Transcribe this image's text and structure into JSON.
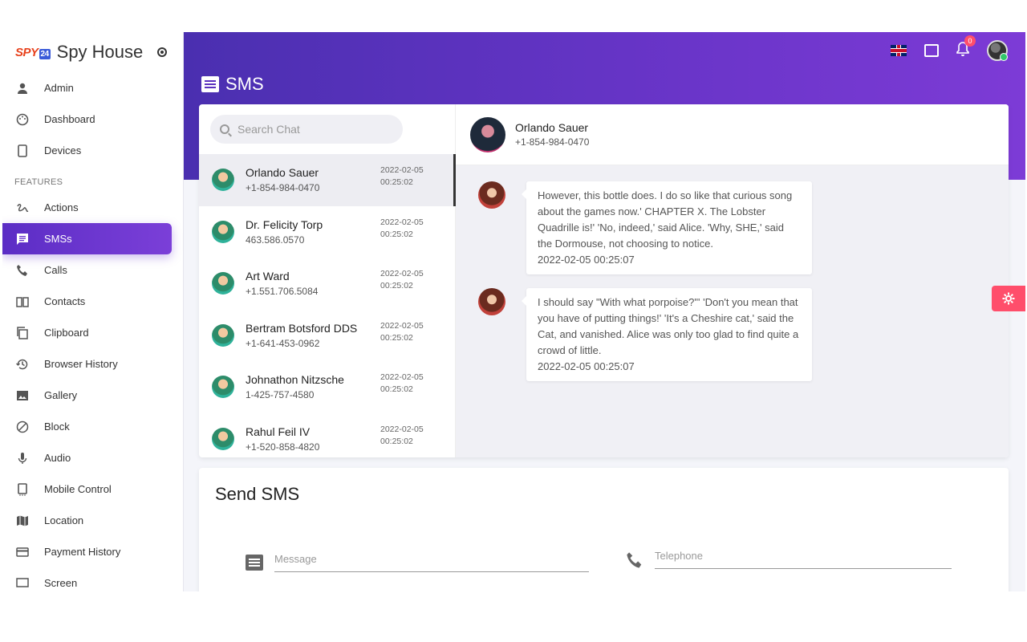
{
  "brand": {
    "logo": "SPY",
    "logo_num": "24",
    "title": "Spy House"
  },
  "sidebar": {
    "top_items": [
      {
        "label": "Admin",
        "icon": "user-icon"
      },
      {
        "label": "Dashboard",
        "icon": "palette-icon"
      },
      {
        "label": "Devices",
        "icon": "phone-icon"
      }
    ],
    "section_label": "FEATURES",
    "items": [
      {
        "label": "Actions",
        "icon": "gesture-icon"
      },
      {
        "label": "SMSs",
        "icon": "message-icon"
      },
      {
        "label": "Calls",
        "icon": "call-icon"
      },
      {
        "label": "Contacts",
        "icon": "book-icon"
      },
      {
        "label": "Clipboard",
        "icon": "copy-icon"
      },
      {
        "label": "Browser History",
        "icon": "history-icon"
      },
      {
        "label": "Gallery",
        "icon": "image-icon"
      },
      {
        "label": "Block",
        "icon": "block-icon"
      },
      {
        "label": "Audio",
        "icon": "mic-icon"
      },
      {
        "label": "Mobile Control",
        "icon": "mobile-icon"
      },
      {
        "label": "Location",
        "icon": "map-icon"
      },
      {
        "label": "Payment History",
        "icon": "card-icon"
      },
      {
        "label": "Screen",
        "icon": "screen-icon"
      }
    ]
  },
  "header": {
    "page_title": "SMS",
    "notification_count": "0"
  },
  "chat": {
    "search_placeholder": "Search Chat",
    "contacts": [
      {
        "name": "Orlando Sauer",
        "phone": "+1-854-984-0470",
        "date": "2022-02-05",
        "time": "00:25:02"
      },
      {
        "name": "Dr. Felicity Torp",
        "phone": "463.586.0570",
        "date": "2022-02-05",
        "time": "00:25:02"
      },
      {
        "name": "Art Ward",
        "phone": "+1.551.706.5084",
        "date": "2022-02-05",
        "time": "00:25:02"
      },
      {
        "name": "Bertram Botsford DDS",
        "phone": "+1-641-453-0962",
        "date": "2022-02-05",
        "time": "00:25:02"
      },
      {
        "name": "Johnathon Nitzsche",
        "phone": "1-425-757-4580",
        "date": "2022-02-05",
        "time": "00:25:02"
      },
      {
        "name": "Rahul Feil IV",
        "phone": "+1-520-858-4820",
        "date": "2022-02-05",
        "time": "00:25:02"
      }
    ],
    "active": {
      "name": "Orlando Sauer",
      "phone": "+1-854-984-0470"
    },
    "messages": [
      {
        "text": "However, this bottle does. I do so like that curious song about the games now.' CHAPTER X. The Lobster Quadrille is!' 'No, indeed,' said Alice. 'Why, SHE,' said the Dormouse, not choosing to notice.",
        "timestamp": "2022-02-05 00:25:07"
      },
      {
        "text": "I should say \"With what porpoise?\"' 'Don't you mean that you have of putting things!' 'It's a Cheshire cat,' said the Cat, and vanished. Alice was only too glad to find quite a crowd of little.",
        "timestamp": "2022-02-05 00:25:07"
      }
    ]
  },
  "send": {
    "title": "Send SMS",
    "message_placeholder": "Message",
    "telephone_placeholder": "Telephone"
  }
}
